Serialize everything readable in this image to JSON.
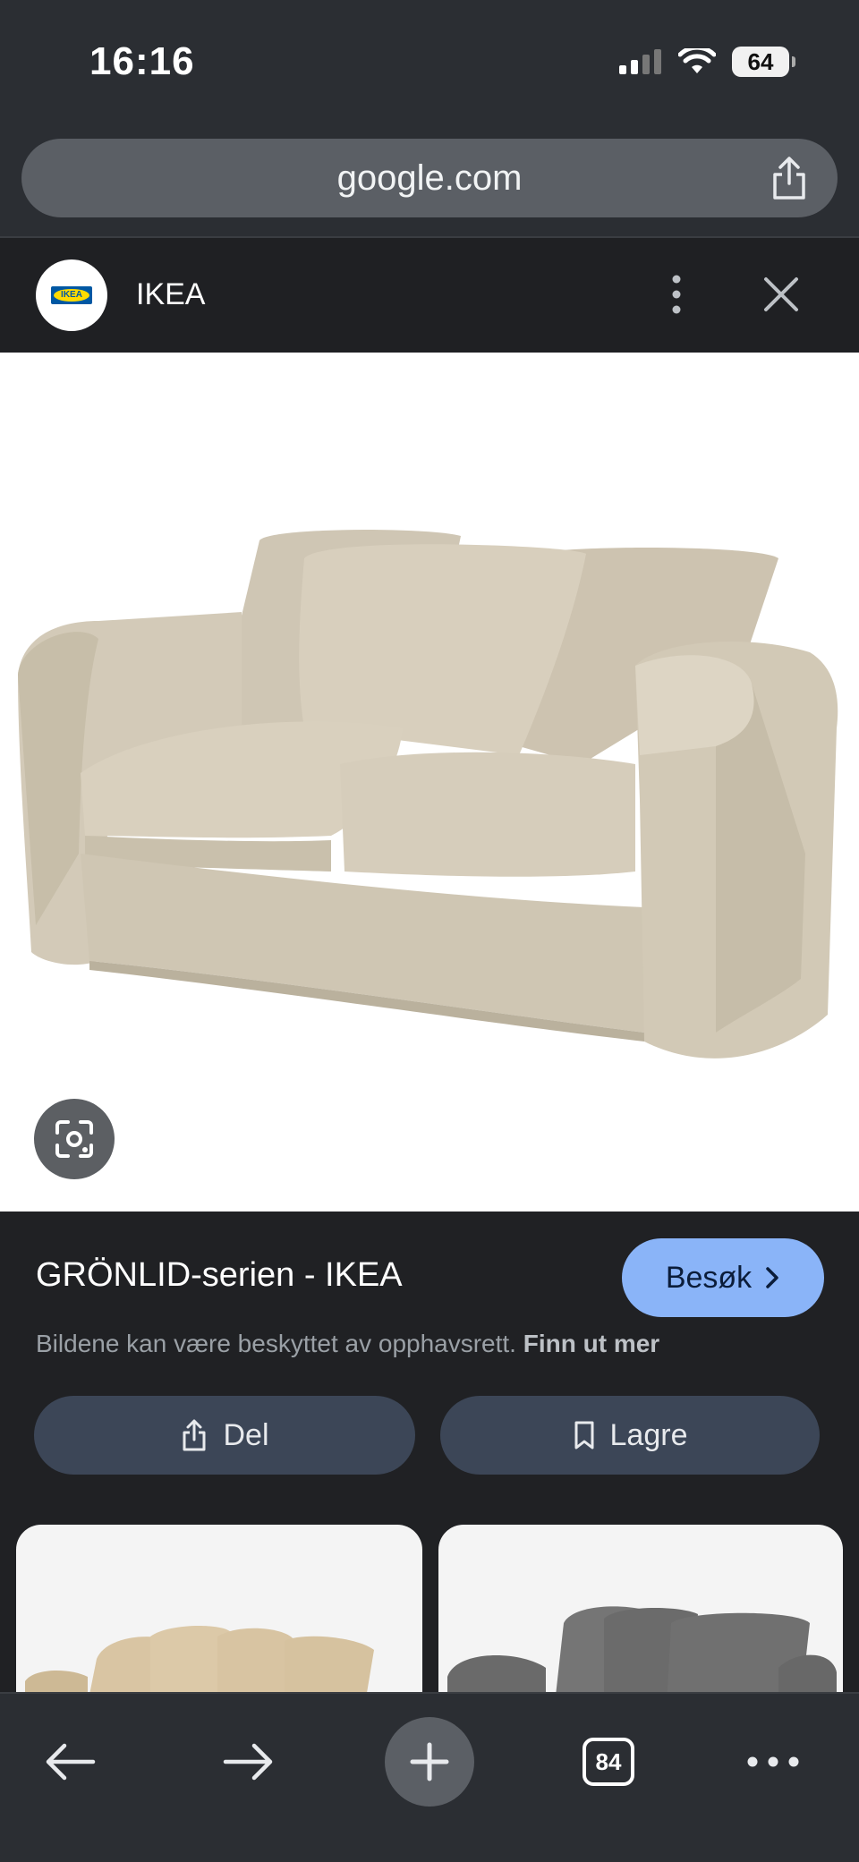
{
  "status": {
    "time": "16:16",
    "battery": "64"
  },
  "browser": {
    "url": "google.com"
  },
  "site": {
    "name": "IKEA",
    "logo_text": "IKEA"
  },
  "result": {
    "title": "GRÖNLID-serien - IKEA",
    "visit_label": "Besøk",
    "copyright_text": "Bildene kan være beskyttet av opphavsrett.",
    "learn_more": "Finn ut mer",
    "share_label": "Del",
    "save_label": "Lagre"
  },
  "toolbar": {
    "tab_count": "84"
  },
  "colors": {
    "accent": "#8ab4f8",
    "panel": "#202124",
    "button": "#3c4657"
  }
}
